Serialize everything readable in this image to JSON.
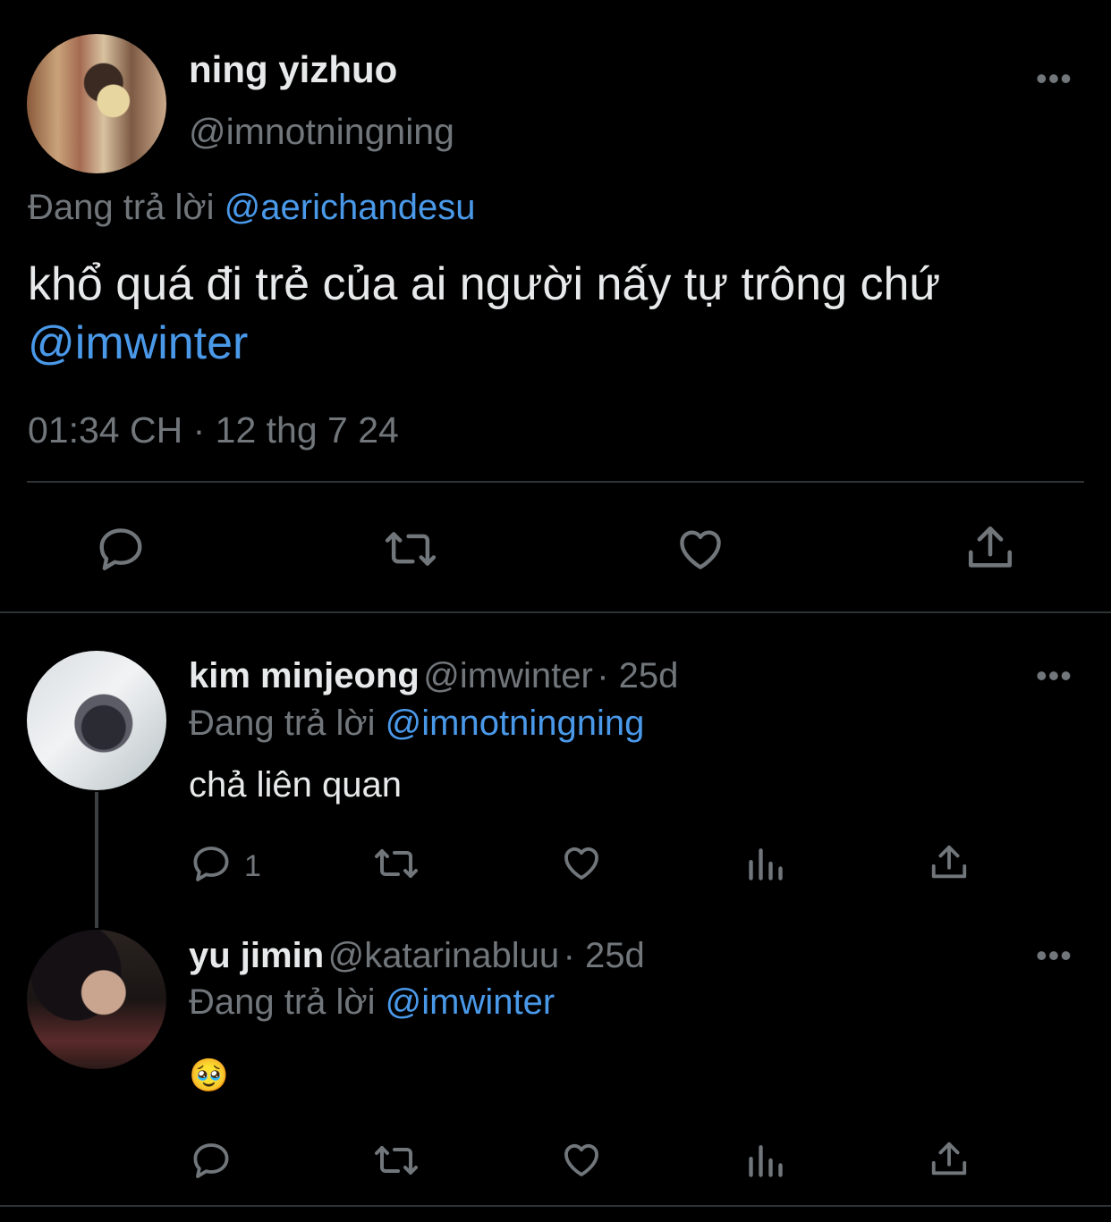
{
  "main_tweet": {
    "author_name": "ning yizhuo",
    "author_handle": "@imnotningning",
    "reply_prefix": "Đang trả lời",
    "reply_to": "@aerichandesu",
    "text": "khổ quá đi trẻ của ai người nấy tự trông chứ",
    "mention": "@imwinter",
    "timestamp": "01:34 CH · 12 thg 7 24",
    "more_label": "•••",
    "actions": [
      "reply-icon",
      "retweet-icon",
      "like-icon",
      "share-icon"
    ]
  },
  "replies": [
    {
      "author_name": "kim minjeong",
      "author_handle": "@imwinter",
      "age": "· 25d",
      "reply_prefix": "Đang trả lời",
      "reply_to": "@imnotningning",
      "text": "chả liên quan",
      "reply_count": "1",
      "more_label": "•••"
    },
    {
      "author_name": "yu jimin",
      "author_handle": "@katarinabluu",
      "age": "· 25d",
      "reply_prefix": "Đang trả lời",
      "reply_to": "@imwinter",
      "text": "🥹",
      "reply_count": "",
      "more_label": "•••"
    }
  ],
  "colors": {
    "background": "#000000",
    "text": "#e7e9ea",
    "muted": "#71767b",
    "link": "#4a99e9",
    "divider": "#2f3336"
  }
}
